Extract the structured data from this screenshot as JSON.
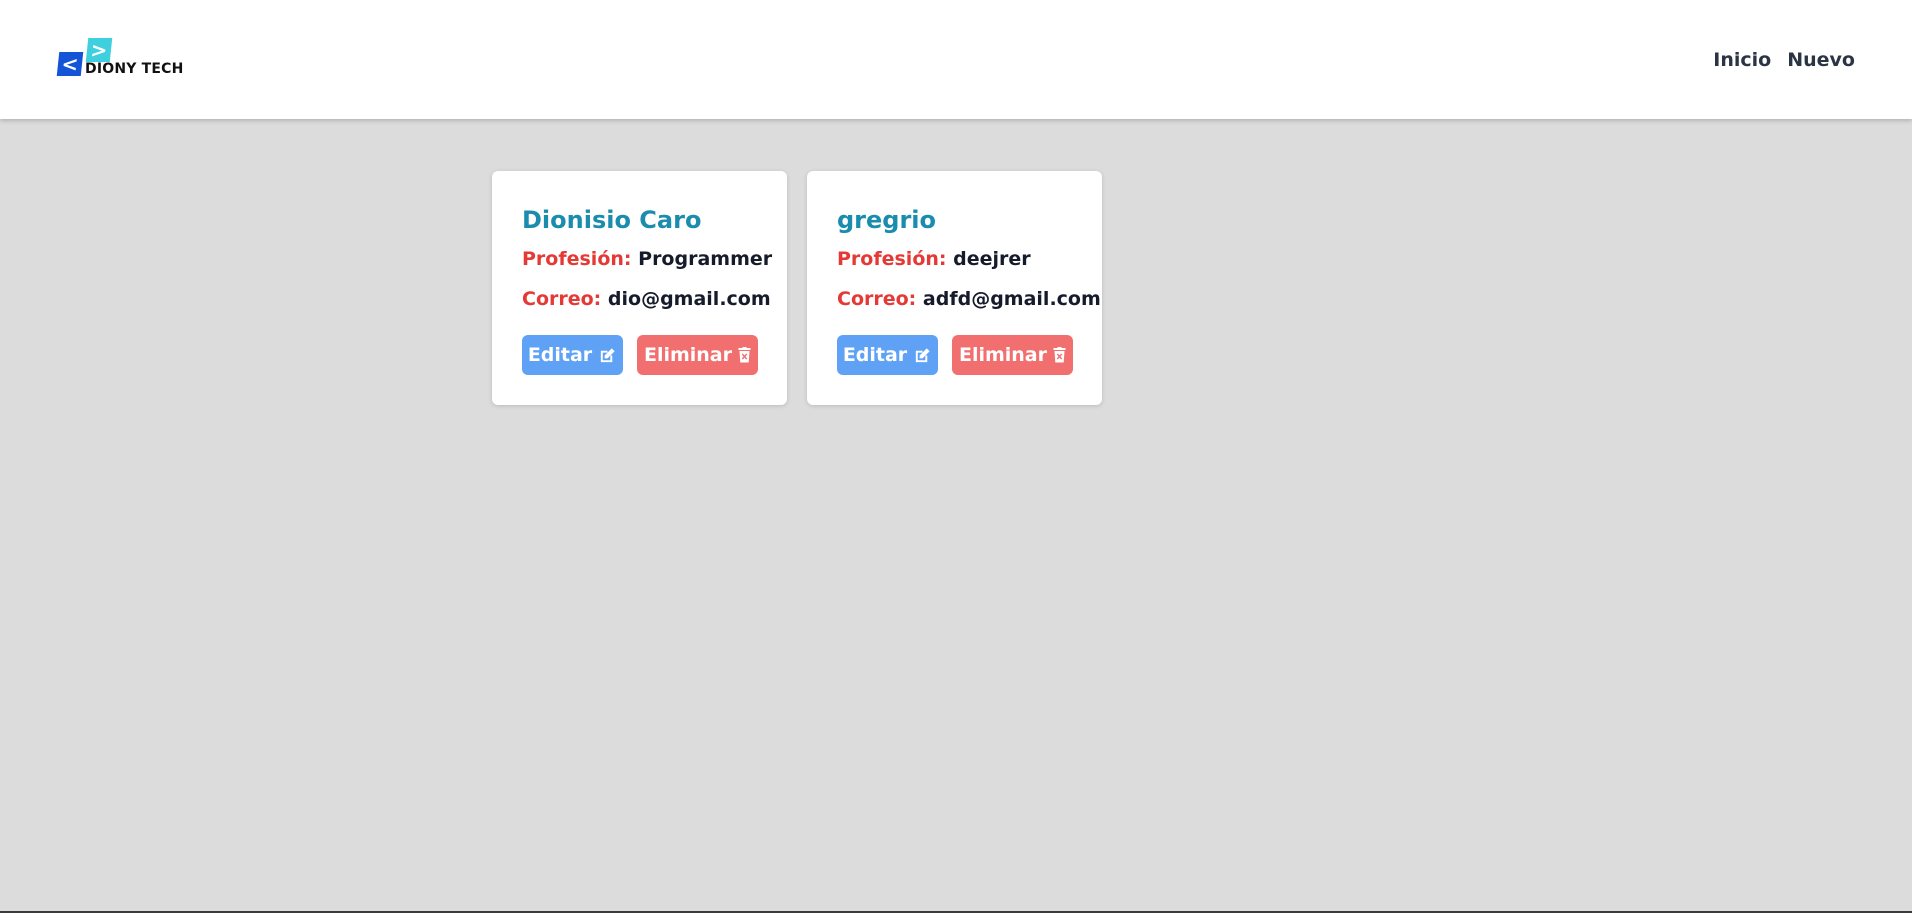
{
  "brand": {
    "logo_left_glyph": "<",
    "logo_right_glyph": ">",
    "name": "DIONY TECH",
    "colors": {
      "primary": "#1554d6",
      "secondary": "#3fd0e0"
    }
  },
  "nav": {
    "links": [
      {
        "label": "Inicio"
      },
      {
        "label": "Nuevo"
      }
    ]
  },
  "cards": [
    {
      "name": "Dionisio Caro",
      "profession_label": "Profesión:",
      "profession": "Programmer",
      "email_label": "Correo:",
      "email": "dio@gmail.com",
      "edit_label": "Editar",
      "delete_label": "Eliminar"
    },
    {
      "name": "gregrio",
      "profession_label": "Profesión:",
      "profession": "deejrer",
      "email_label": "Correo:",
      "email": "adfd@gmail.com",
      "edit_label": "Editar",
      "delete_label": "Eliminar"
    }
  ],
  "icons": {
    "edit": "edit-icon",
    "delete": "trash-icon"
  },
  "theme": {
    "background": "#dcdcdc",
    "title_color": "#1a8cae",
    "label_color": "#e53935",
    "edit_button": "#5fa2f5",
    "delete_button": "#f26f6f"
  }
}
